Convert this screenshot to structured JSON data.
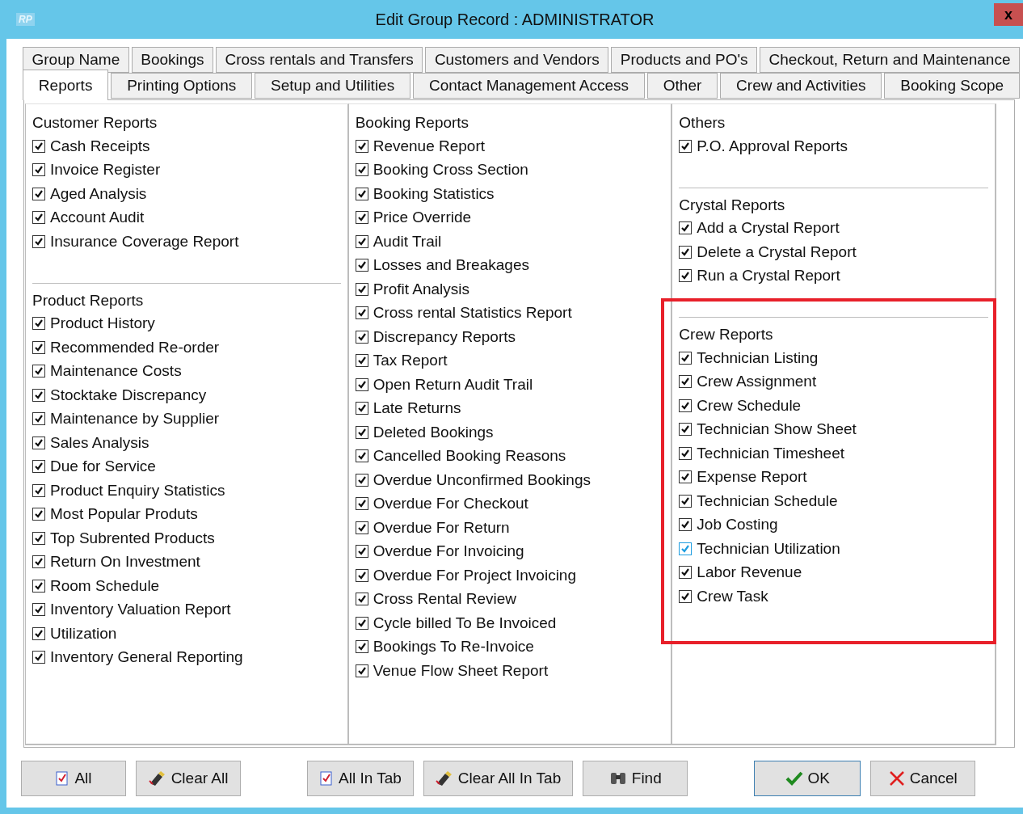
{
  "window": {
    "badge": "RP",
    "title": "Edit Group Record : ADMINISTRATOR",
    "close": "x"
  },
  "tab_rows": [
    [
      {
        "label": "Group Name",
        "selected": false
      },
      {
        "label": "Bookings",
        "selected": false
      },
      {
        "label": "Cross rentals and Transfers",
        "selected": false
      },
      {
        "label": "Customers and Vendors",
        "selected": false
      },
      {
        "label": "Products and PO's",
        "selected": false
      },
      {
        "label": "Checkout, Return and Maintenance",
        "selected": false
      }
    ],
    [
      {
        "label": "Reports",
        "selected": true
      },
      {
        "label": "Printing Options",
        "selected": false
      },
      {
        "label": "Setup and Utilities",
        "selected": false
      },
      {
        "label": "Contact Management Access",
        "selected": false
      },
      {
        "label": "Other",
        "selected": false
      },
      {
        "label": "Crew and Activities",
        "selected": false
      },
      {
        "label": "Booking Scope",
        "selected": false
      }
    ]
  ],
  "columns": [
    {
      "sections": [
        {
          "title": "Customer Reports",
          "highlighted": false,
          "items": [
            {
              "label": "Cash Receipts",
              "checked": true
            },
            {
              "label": "Invoice Register",
              "checked": true
            },
            {
              "label": "Aged Analysis",
              "checked": true
            },
            {
              "label": "Account Audit",
              "checked": true
            },
            {
              "label": "Insurance Coverage Report",
              "checked": true
            }
          ]
        },
        {
          "title": "Product Reports",
          "highlighted": false,
          "items": [
            {
              "label": "Product History",
              "checked": true
            },
            {
              "label": "Recommended Re-order",
              "checked": true
            },
            {
              "label": "Maintenance Costs",
              "checked": true
            },
            {
              "label": "Stocktake Discrepancy",
              "checked": true
            },
            {
              "label": "Maintenance by Supplier",
              "checked": true
            },
            {
              "label": "Sales Analysis",
              "checked": true
            },
            {
              "label": "Due for Service",
              "checked": true
            },
            {
              "label": "Product Enquiry Statistics",
              "checked": true
            },
            {
              "label": "Most Popular Produts",
              "checked": true
            },
            {
              "label": "Top Subrented Products",
              "checked": true
            },
            {
              "label": "Return On Investment",
              "checked": true
            },
            {
              "label": "Room Schedule",
              "checked": true
            },
            {
              "label": "Inventory Valuation Report",
              "checked": true
            },
            {
              "label": "Utilization",
              "checked": true
            },
            {
              "label": "Inventory General Reporting",
              "checked": true
            }
          ]
        }
      ]
    },
    {
      "sections": [
        {
          "title": "Booking Reports",
          "highlighted": false,
          "items": [
            {
              "label": "Revenue Report",
              "checked": true
            },
            {
              "label": "Booking Cross Section",
              "checked": true
            },
            {
              "label": "Booking Statistics",
              "checked": true
            },
            {
              "label": "Price Override",
              "checked": true
            },
            {
              "label": "Audit Trail",
              "checked": true
            },
            {
              "label": "Losses and Breakages",
              "checked": true
            },
            {
              "label": "Profit Analysis",
              "checked": true
            },
            {
              "label": "Cross rental Statistics Report",
              "checked": true
            },
            {
              "label": "Discrepancy Reports",
              "checked": true
            },
            {
              "label": "Tax Report",
              "checked": true
            },
            {
              "label": "Open Return Audit Trail",
              "checked": true
            },
            {
              "label": "Late Returns",
              "checked": true
            },
            {
              "label": "Deleted Bookings",
              "checked": true
            },
            {
              "label": "Cancelled Booking Reasons",
              "checked": true
            },
            {
              "label": "Overdue Unconfirmed Bookings",
              "checked": true
            },
            {
              "label": "Overdue For Checkout",
              "checked": true
            },
            {
              "label": "Overdue For Return",
              "checked": true
            },
            {
              "label": "Overdue For Invoicing",
              "checked": true
            },
            {
              "label": "Overdue For Project Invoicing",
              "checked": true
            },
            {
              "label": "Cross Rental Review",
              "checked": true
            },
            {
              "label": "Cycle billed To Be Invoiced",
              "checked": true
            },
            {
              "label": "Bookings To Re-Invoice",
              "checked": true
            },
            {
              "label": "Venue Flow Sheet Report",
              "checked": true
            }
          ]
        }
      ]
    },
    {
      "sections": [
        {
          "title": "Others",
          "highlighted": false,
          "items": [
            {
              "label": "P.O. Approval Reports",
              "checked": true
            }
          ]
        },
        {
          "title": "Crystal Reports",
          "highlighted": false,
          "items": [
            {
              "label": "Add a Crystal Report",
              "checked": true
            },
            {
              "label": "Delete a Crystal Report",
              "checked": true
            },
            {
              "label": "Run a Crystal Report",
              "checked": true
            }
          ]
        },
        {
          "title": "Crew Reports",
          "highlighted": true,
          "items": [
            {
              "label": "Technician Listing",
              "checked": true,
              "hovered": false
            },
            {
              "label": "Crew Assignment",
              "checked": true,
              "hovered": false
            },
            {
              "label": "Crew Schedule",
              "checked": true,
              "hovered": false
            },
            {
              "label": "Technician Show Sheet",
              "checked": true,
              "hovered": false
            },
            {
              "label": "Technician Timesheet",
              "checked": true,
              "hovered": false
            },
            {
              "label": "Expense Report",
              "checked": true,
              "hovered": false
            },
            {
              "label": "Technician Schedule",
              "checked": true,
              "hovered": false
            },
            {
              "label": "Job Costing",
              "checked": true,
              "hovered": false
            },
            {
              "label": "Technician Utilization",
              "checked": true,
              "hovered": true
            },
            {
              "label": "Labor Revenue",
              "checked": true,
              "hovered": false
            },
            {
              "label": "Crew Task",
              "checked": true,
              "hovered": false
            }
          ]
        }
      ]
    }
  ],
  "buttons": [
    {
      "kind": "check-all",
      "label": "All"
    },
    {
      "kind": "clear",
      "label": "Clear All"
    },
    {
      "kind": "gap"
    },
    {
      "kind": "check-all",
      "label": "All In Tab"
    },
    {
      "kind": "clear",
      "label": "Clear All In Tab"
    },
    {
      "kind": "find",
      "label": "Find"
    },
    {
      "kind": "gap"
    },
    {
      "kind": "ok",
      "label": "OK"
    },
    {
      "kind": "cancel",
      "label": "Cancel"
    }
  ]
}
